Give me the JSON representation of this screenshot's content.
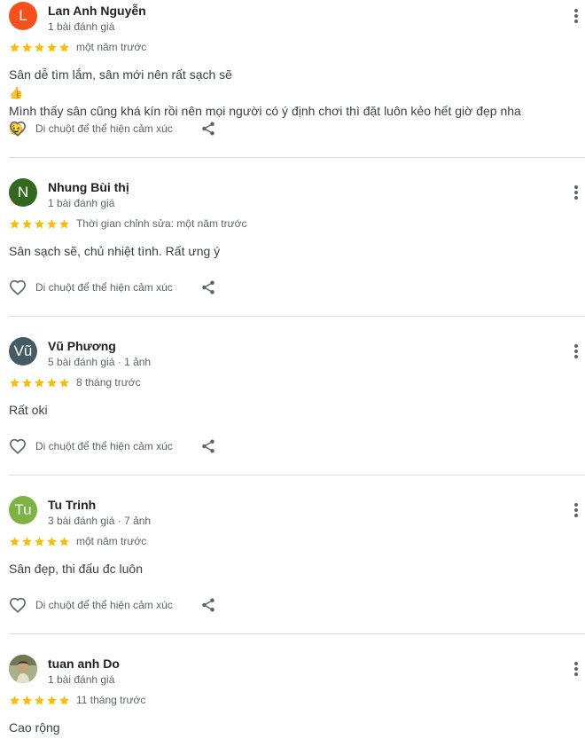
{
  "reviews": [
    {
      "name": "Lan Anh Nguyễn",
      "meta": "1 bài đánh giá",
      "avatar_letter": "L",
      "avatar_color": "#f4511e",
      "rating": 5,
      "time": "một năm trước",
      "lines": [
        "Sân dễ tìm lắm, sân mới nên rất sạch sẽ",
        "Mình thấy sân cũng khá kín rồi nên mọi người có ý định chơi thì đặt luôn kẻo hết giờ đẹp nha"
      ],
      "emoji1": "👍",
      "emoji2": "😉",
      "react_label": "Di chuột để thể hiện cảm xúc"
    },
    {
      "name": "Nhung Bùi thị",
      "meta": "1 bài đánh giá",
      "avatar_letter": "N",
      "avatar_color": "#33691e",
      "rating": 5,
      "time": "Thời gian chỉnh sửa: một năm trước",
      "lines": [
        "Sân sạch sẽ, chủ nhiệt tình. Rất ưng ý"
      ],
      "react_label": "Di chuột để thể hiện cảm xúc"
    },
    {
      "name": "Vũ Phương",
      "meta": "5 bài đánh giá · 1 ảnh",
      "avatar_letter": "Vũ",
      "avatar_color": "#455a64",
      "rating": 5,
      "time": "8 tháng trước",
      "lines": [
        "Rất oki"
      ],
      "react_label": "Di chuột để thể hiện cảm xúc"
    },
    {
      "name": "Tu Trinh",
      "meta": "3 bài đánh giá · 7 ảnh",
      "avatar_letter": "Tu",
      "avatar_color": "#7cb342",
      "rating": 5,
      "time": "một năm trước",
      "lines": [
        "Sân đẹp, thi đấu đc luôn"
      ],
      "react_label": "Di chuột để thể hiện cảm xúc"
    },
    {
      "name": "tuan anh Do",
      "meta": "1 bài đánh giá",
      "avatar_letter": "",
      "avatar_color": "#8d8a6a",
      "rating": 5,
      "time": "11 tháng trước",
      "lines": [
        "Cao rộng"
      ]
    }
  ],
  "colors": {
    "star": "#fbbc04",
    "icon": "#5f6368",
    "divider": "#dadce0"
  },
  "icons": {
    "more": "more-vertical-icon",
    "heart": "heart-outline-icon",
    "share": "share-icon",
    "star": "star-icon"
  }
}
